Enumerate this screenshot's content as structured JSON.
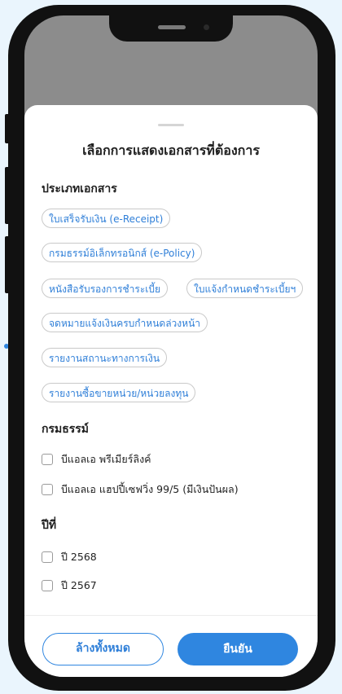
{
  "sheet": {
    "title": "เลือกการแสดงเอกสารที่ต้องการ",
    "doc_type_section": "ประเภทเอกสาร",
    "doc_types": [
      "ใบเสร็จรับเงิน (e-Receipt)",
      "กรมธรรม์อิเล็กทรอนิกส์ (e-Policy)",
      "หนังสือรับรองการชำระเบี้ย",
      "ใบแจ้งกำหนดชำระเบี้ยฯ",
      "จดหมายแจ้งเงินครบกำหนดล่วงหน้า",
      "รายงานสถานะทางการเงิน",
      "รายงานซื้อขายหน่วย/หน่วยลงทุน"
    ],
    "policy_section": "กรมธรรม์",
    "policies": [
      "บีแอลเอ พรีเมียร์ลิงค์",
      "บีแอลเอ แฮปปี้เซฟวิ่ง 99/5 (มีเงินปันผล)"
    ],
    "year_section": "ปีที่",
    "years": [
      "ปี 2568",
      "ปี 2567"
    ],
    "clear_button": "ล้างทั้งหมด",
    "confirm_button": "ยืนยัน"
  },
  "colors": {
    "accent": "#2f86e0",
    "background": "#eaf5fd"
  }
}
